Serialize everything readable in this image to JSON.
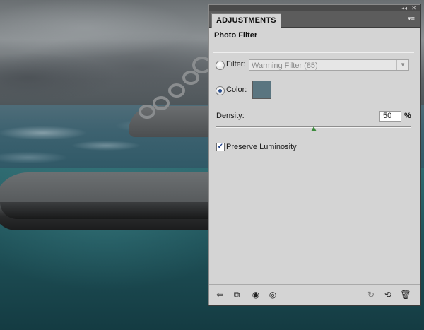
{
  "panel": {
    "tab_label": "ADJUSTMENTS",
    "title": "Photo Filter",
    "filter": {
      "label": "Filter:",
      "selected": "Warming Filter (85)",
      "checked": false
    },
    "color": {
      "label": "Color:",
      "checked": true,
      "swatch": "#5a7580"
    },
    "density": {
      "label": "Density:",
      "value": "50",
      "unit": "%",
      "level": 0.5
    },
    "preserve_luminosity": {
      "label": "Preserve Luminosity",
      "checked": true
    },
    "icons": {
      "titlebar": [
        "collapse-icon",
        "close-icon"
      ],
      "menu": "panel-menu-icon",
      "footer_left": [
        "back-arrow-icon",
        "clip-to-layer-icon",
        "visibility-toggle-icon",
        "eye-icon"
      ],
      "footer_right": [
        "view-previous-icon",
        "reset-icon",
        "delete-icon"
      ]
    }
  },
  "colors": {
    "panel_bg": "#d4d4d4",
    "tabbar_bg": "#5c5c5c",
    "slider_thumb": "#3c8a3c",
    "radio_on": "#2a4f8f"
  }
}
